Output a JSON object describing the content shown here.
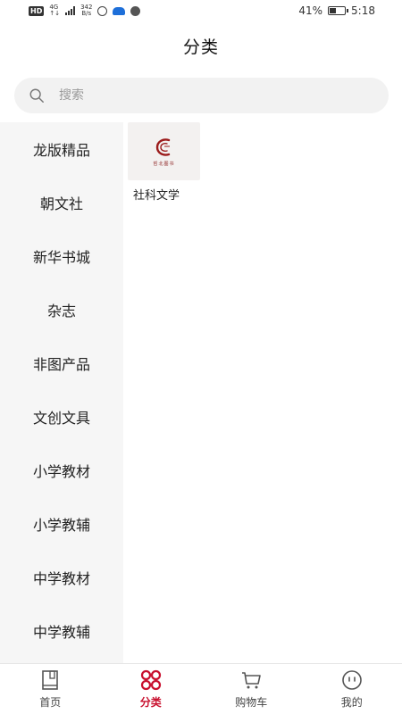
{
  "status_bar": {
    "hd": "HD",
    "network": "4G",
    "speed_value": "342",
    "speed_unit": "B/s",
    "battery": "41%",
    "time": "5:18",
    "battery_level": 0.41
  },
  "header": {
    "title": "分类"
  },
  "search": {
    "placeholder": "搜索"
  },
  "sidebar": {
    "items": [
      {
        "label": "龙版精品"
      },
      {
        "label": "朝文社"
      },
      {
        "label": "新华书城"
      },
      {
        "label": "杂志"
      },
      {
        "label": "非图产品"
      },
      {
        "label": "文创文具"
      },
      {
        "label": "小学教材"
      },
      {
        "label": "小学教辅"
      },
      {
        "label": "中学教材"
      },
      {
        "label": "中学教辅"
      }
    ]
  },
  "content": {
    "subcategories": [
      {
        "label": "社科文学",
        "brand": "哲北图书"
      }
    ]
  },
  "tabbar": {
    "active_color": "#c8102e",
    "items": [
      {
        "label": "首页",
        "icon": "book-icon"
      },
      {
        "label": "分类",
        "icon": "category-grid-icon"
      },
      {
        "label": "购物车",
        "icon": "cart-icon"
      },
      {
        "label": "我的",
        "icon": "profile-face-icon"
      }
    ]
  }
}
